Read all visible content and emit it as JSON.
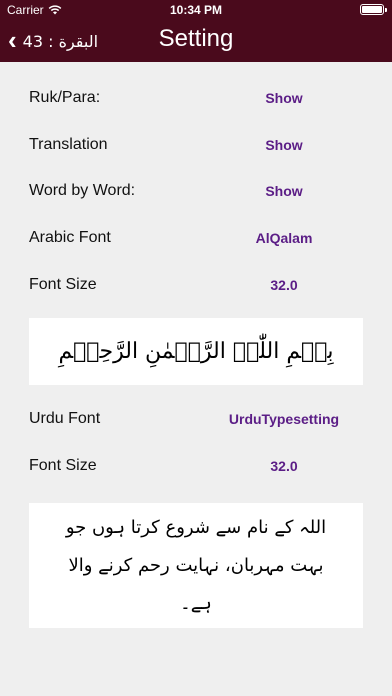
{
  "status_bar": {
    "carrier": "Carrier",
    "time": "10:34 PM"
  },
  "nav": {
    "back_label": "البقرة : 43",
    "title": "Setting"
  },
  "settings": {
    "ruk_para": {
      "label": "Ruk/Para:",
      "value": "Show"
    },
    "translation": {
      "label": "Translation",
      "value": "Show"
    },
    "word_by_word": {
      "label": "Word by Word:",
      "value": "Show"
    },
    "arabic_font": {
      "label": "Arabic Font",
      "value": "AlQalam"
    },
    "arabic_font_size": {
      "label": "Font Size",
      "value": "32.0"
    },
    "urdu_font": {
      "label": "Urdu Font",
      "value": "UrduTypesetting"
    },
    "urdu_font_size": {
      "label": "Font Size",
      "value": "32.0"
    }
  },
  "previews": {
    "arabic_text": "بِسۡمِ اللّٰہِ الرَّحۡمٰنِ الرَّحِیۡمِ",
    "urdu_text": "اللہ کے نام سے شروع کرتا ہوں جو بہت مہربان، نہایت رحم کرنے والا ہے۔"
  },
  "colors": {
    "header_bg": "#4a0a1c",
    "value_text": "#5b1d86",
    "page_bg": "#efefef"
  }
}
